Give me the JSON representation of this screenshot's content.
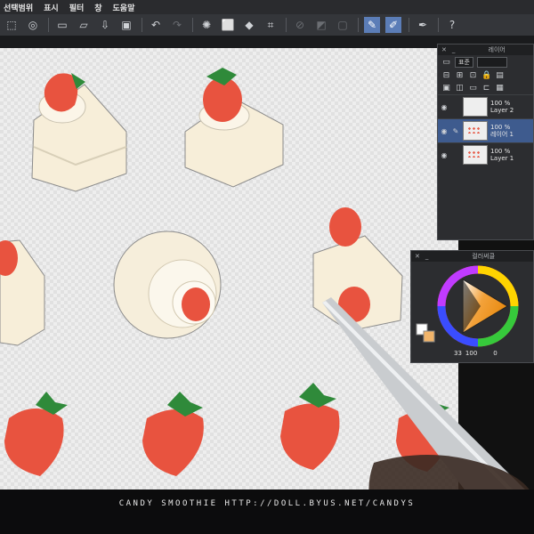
{
  "menu": [
    "선택범위",
    "표시",
    "필터",
    "창",
    "도움말"
  ],
  "toolbar": {
    "icons": [
      "pattern-icon",
      "gear-icon",
      "new-file-icon",
      "open-folder-icon",
      "save-icon",
      "undo-icon",
      "redo-icon",
      "loading-icon",
      "transform-icon",
      "fill-icon",
      "crop-icon",
      "clear-selection-icon",
      "invert-icon",
      "mask-icon",
      "pen-icon",
      "brush-icon",
      "ruler-pen-icon",
      "help-icon"
    ]
  },
  "layer_panel": {
    "title": "레이어",
    "blend_mode": "표준",
    "layers": [
      {
        "opacity": "100 %",
        "name": "Layer 2",
        "selected": false
      },
      {
        "opacity": "100 %",
        "name": "레이어 1",
        "selected": true
      },
      {
        "opacity": "100 %",
        "name": "Layer 1",
        "selected": false
      }
    ]
  },
  "color_panel": {
    "title": "컬러써클",
    "hsv_h": "33",
    "hsv_s": "100",
    "hsv_v": "0",
    "main_color": "#ffffff",
    "sub_color": "#f1b46a"
  },
  "watermark": "CANDY SMOOTHIE HTTP://DOLL.BYUS.NET/CANDYS",
  "colors": {
    "strawberry": "#e8533f",
    "leaf": "#2f8a3a",
    "cream": "#f7eed9"
  }
}
